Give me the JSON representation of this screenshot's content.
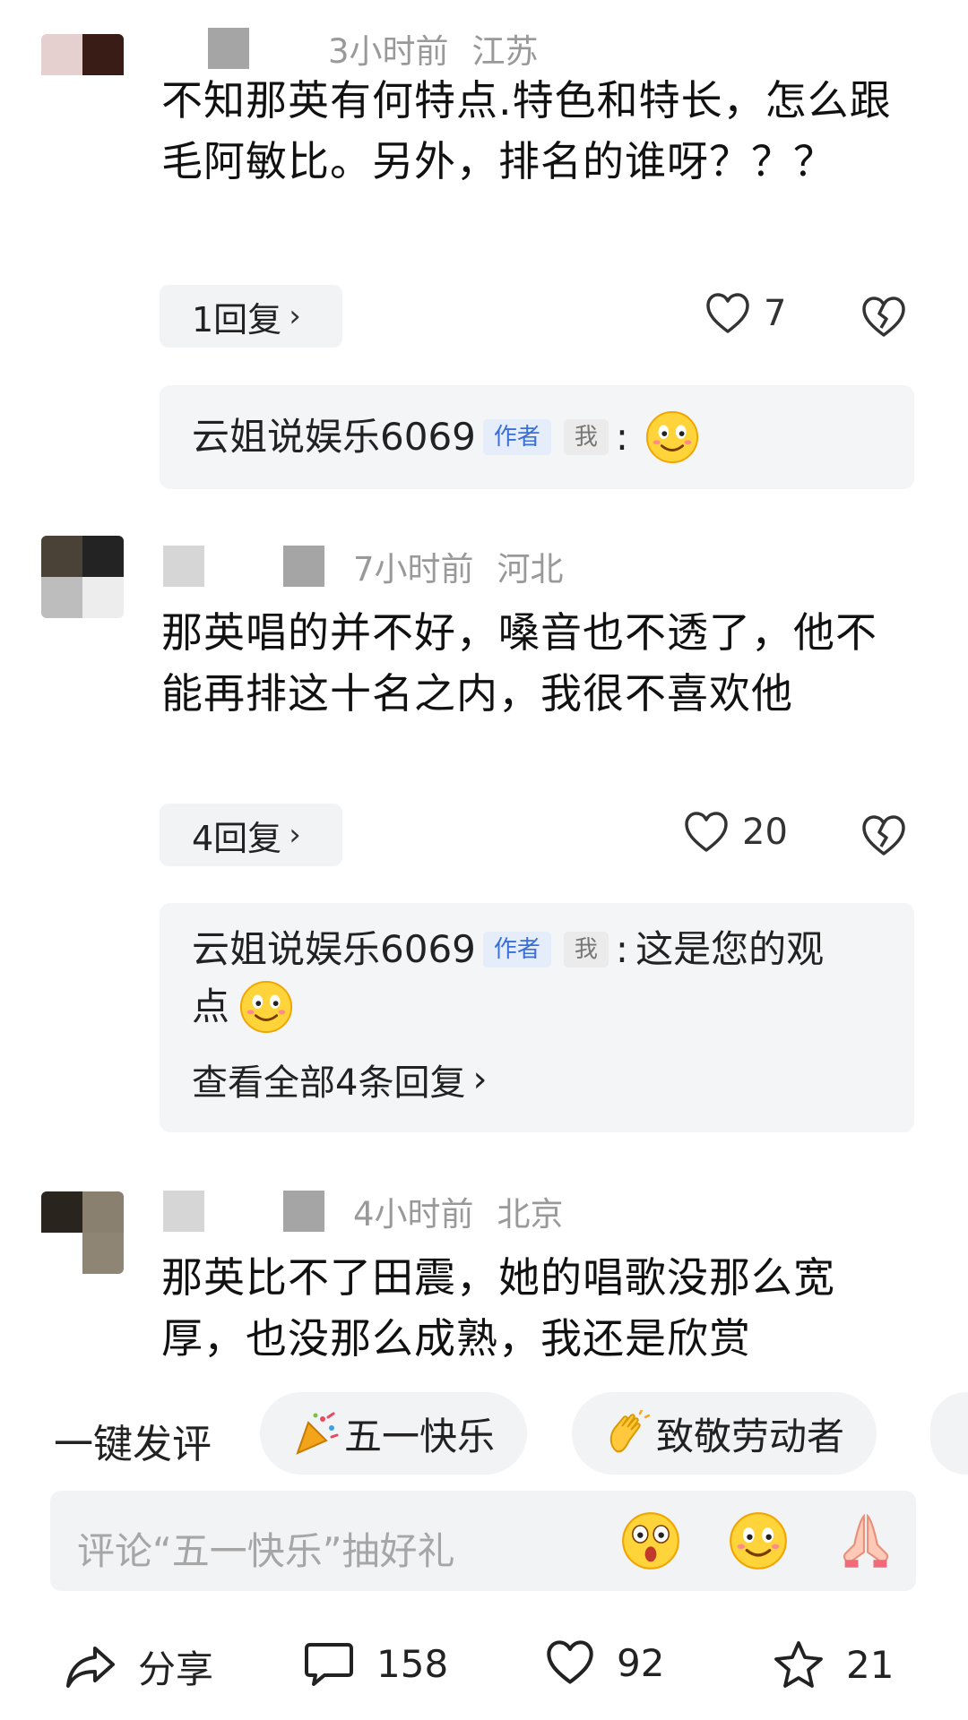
{
  "comments": [
    {
      "time": "3小时前",
      "location": "江苏",
      "text": "不知那英有何特点.特色和特长，怎么跟毛阿敏比。另外，排名的谁呀？？？",
      "reply_count_label": "1回复",
      "likes": "7",
      "author_reply": {
        "name": "云姐说娱乐6069",
        "author_tag": "作者",
        "me_tag": "我",
        "sep": ":",
        "text": ""
      }
    },
    {
      "time": "7小时前",
      "location": "河北",
      "text": "那英唱的并不好，嗓音也不透了，他不能再排这十名之内，我很不喜欢他",
      "reply_count_label": "4回复",
      "likes": "20",
      "author_reply": {
        "name": "云姐说娱乐6069",
        "author_tag": "作者",
        "me_tag": "我",
        "sep": ":",
        "text_line1": "这是您的观",
        "text_line2": "点"
      },
      "see_all_label": "查看全部4条回复"
    },
    {
      "time": "4小时前",
      "location": "北京",
      "text": "那英比不了田震，她的唱歌没那么宽厚，也没那么成熟，我还是欣赏"
    }
  ],
  "quick_comment": {
    "label": "一键发评",
    "chips": [
      "五一快乐",
      "致敬劳动者"
    ]
  },
  "input": {
    "placeholder": "评论“五一快乐”抽好礼"
  },
  "bottom_bar": {
    "share_label": "分享",
    "comments_count": "158",
    "likes_count": "92",
    "favorites_count": "21"
  },
  "colors": {
    "author_tag": "#3a6fd8",
    "background": "#ffffff",
    "chip_bg": "#f2f3f5"
  }
}
